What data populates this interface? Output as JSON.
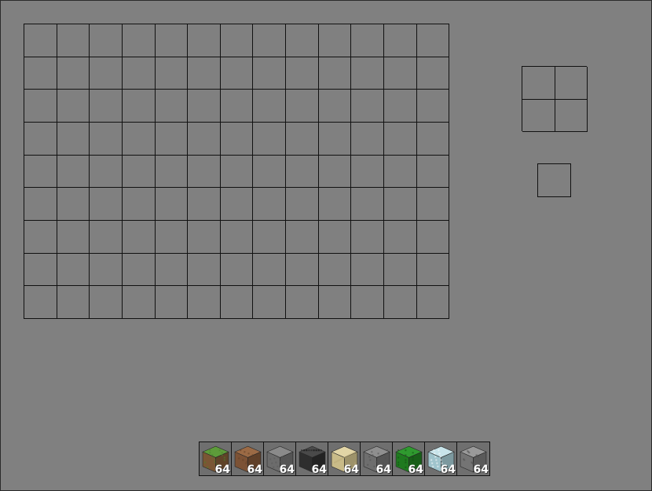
{
  "inventory": {
    "rows": 9,
    "cols": 13
  },
  "crafting": {
    "rows": 2,
    "cols": 2
  },
  "hotbar": [
    {
      "block": "grass-block",
      "count": "64",
      "colors": {
        "top": "#5d9b3a",
        "side": "#7a5634",
        "accent": "#4a7f2c"
      }
    },
    {
      "block": "dirt-block",
      "count": "64",
      "colors": {
        "top": "#9b6a45",
        "side": "#7c5235",
        "accent": "#5d3c25"
      }
    },
    {
      "block": "stone-block",
      "count": "64",
      "colors": {
        "top": "#8a8a8a",
        "side": "#6c6c6c",
        "accent": "#5a5a5a"
      }
    },
    {
      "block": "bedrock-block",
      "count": "64",
      "colors": {
        "top": "#4a4a4a",
        "side": "#2e2e2e",
        "accent": "#1a1a1a"
      }
    },
    {
      "block": "sand-block",
      "count": "64",
      "colors": {
        "top": "#e2d5a6",
        "side": "#c9bb88",
        "accent": "#b8a874"
      }
    },
    {
      "block": "cobblestone-gray-block",
      "count": "64",
      "colors": {
        "top": "#8f8f8f",
        "side": "#6e6e6e",
        "accent": "#505050"
      }
    },
    {
      "block": "leaves-block",
      "count": "64",
      "colors": {
        "top": "#2f9a2f",
        "side": "#1f7a1f",
        "accent": "#0f4f0f"
      }
    },
    {
      "block": "glass-block",
      "count": "64",
      "colors": {
        "top": "#c8e4ea",
        "side": "#9fc4cc",
        "accent": "#ffffff"
      }
    },
    {
      "block": "cobblestone-block",
      "count": "64",
      "colors": {
        "top": "#9a9a9a",
        "side": "#747474",
        "accent": "#4e4e4e"
      }
    }
  ]
}
